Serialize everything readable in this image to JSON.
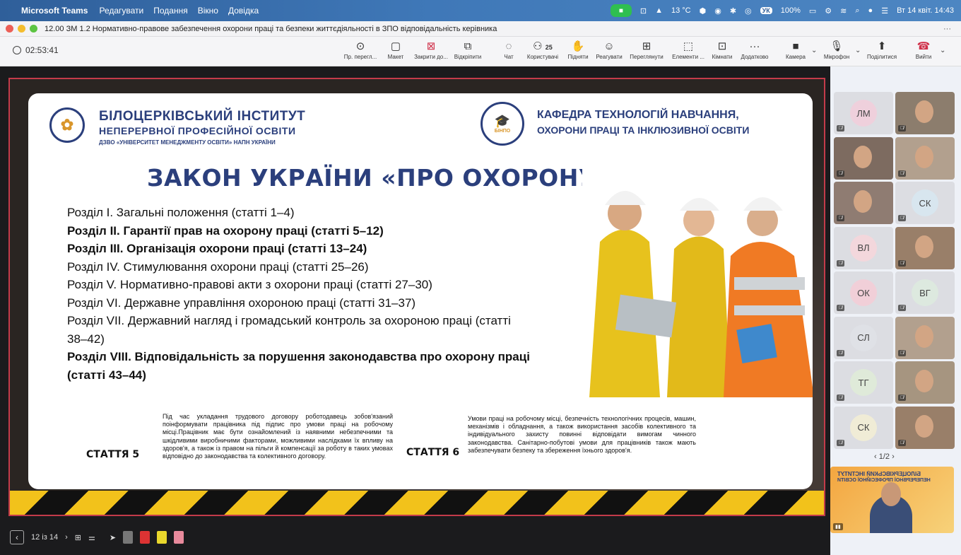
{
  "menubar": {
    "app": "Microsoft Teams",
    "items": [
      "Редагувати",
      "Подання",
      "Вікно",
      "Довідка"
    ],
    "temperature": "13 °C",
    "battery": "100%",
    "lang": "УК",
    "datetime": "Вт 14 квіт. 14:43"
  },
  "window": {
    "title": "12.00 ЗМ 1.2 Нормативно-правове забезпечення охорони праці та безпеки життєдіяльності в ЗПО відповідальність керівника"
  },
  "toolbar": {
    "timer": "02:53:41",
    "buttons": [
      {
        "icon": "view-icon",
        "label": "Пр. перегл..."
      },
      {
        "icon": "layout-icon",
        "label": "Макет"
      },
      {
        "icon": "close-share-icon",
        "label": "Закрити до..."
      },
      {
        "icon": "unpin-icon",
        "label": "Відкріпити"
      },
      {
        "icon": "chat-icon",
        "label": "Чат"
      },
      {
        "icon": "people-icon",
        "label": "Користувачі",
        "badge": "25"
      },
      {
        "icon": "raise-hand-icon",
        "label": "Підняти"
      },
      {
        "icon": "react-icon",
        "label": "Реагувати"
      },
      {
        "icon": "view-grid-icon",
        "label": "Переглянути"
      },
      {
        "icon": "apps-icon",
        "label": "Елементи ..."
      },
      {
        "icon": "rooms-icon",
        "label": "Кімнати"
      },
      {
        "icon": "more-icon",
        "label": "Додатково"
      },
      {
        "icon": "camera-icon",
        "label": "Камера"
      },
      {
        "icon": "mic-icon",
        "label": "Мікрофон"
      },
      {
        "icon": "share-icon",
        "label": "Поділитися"
      },
      {
        "icon": "leave-icon",
        "label": "Вийти"
      }
    ]
  },
  "slide": {
    "inst_line1": "БІЛОЦЕРКІВСЬКИЙ ІНСТИТУТ",
    "inst_line2": "НЕПЕРЕРВНОЇ ПРОФЕСІЙНОЇ ОСВІТИ",
    "inst_line3": "ДЗВО «УНІВЕРСИТЕТ МЕНЕДЖМЕНТУ ОСВІТИ» НАПН УКРАЇНИ",
    "logo_r_text": "БІНПО",
    "kaf_line1": "КАФЕДРА ТЕХНОЛОГІЙ НАВЧАННЯ,",
    "kaf_line2": "ОХОРОНИ ПРАЦІ ТА ІНКЛЮЗИВНОЇ ОСВІТИ",
    "title": "ЗАКОН УКРАЇНИ «ПРО ОХОРОНУ ПРАЦІ»",
    "sections": [
      "Розділ I. Загальні положення (статті 1–4)",
      "Розділ II. Гарантії прав на охорону праці (статті 5–12)",
      "Розділ III. Організація охорони праці (статті 13–24)",
      "Розділ IV. Стимулювання охорони праці (статті 25–26)",
      "Розділ V. Нормативно-правові акти з охорони праці (статті 27–30)",
      "Розділ VI. Державне управління охороною праці (статті 31–37)",
      "Розділ VII. Державний нагляд і громадський контроль за охороною праці (статті 38–42)",
      "Розділ VIII. Відповідальність за порушення законодавства про охорону праці (статті 43–44)"
    ],
    "art5_label": "СТАТТЯ 5",
    "art5_text": "Під час укладання трудового договору роботодавець зобов'язаний поінформувати працівника під підпис про умови праці на робочому місці.Працівник має бути ознайомлений із наявними небезпечними та шкідливими виробничими факторами, можливими наслідками їх впливу на здоров'я, а також із правом на пільги й компенсації за роботу в таких умовах відповідно до законодавства та колективного договору.",
    "art6_label": "СТАТТЯ 6",
    "art6_text": "Умови праці на робочому місці, безпечність технологічних процесів, машин, механізмів і обладнання, а також використання засобів колективного та індивідуального захисту повинні відповідати вимогам чинного законодавства. Санітарно-побутові умови для працівників також мають забезпечувати безпеку та збереження їхнього здоров'я."
  },
  "slidectl": {
    "page": "12 із 14"
  },
  "participants": [
    {
      "initials": "ЛМ",
      "type": "init",
      "color": "#efd0dc"
    },
    {
      "initials": "",
      "type": "cam"
    },
    {
      "initials": "",
      "type": "cam"
    },
    {
      "initials": "",
      "type": "cam"
    },
    {
      "initials": "",
      "type": "cam"
    },
    {
      "initials": "СК",
      "type": "init",
      "color": "#d8e6ef"
    },
    {
      "initials": "ВЛ",
      "type": "init",
      "color": "#f3d7dc"
    },
    {
      "initials": "",
      "type": "cam"
    },
    {
      "initials": "ОК",
      "type": "init",
      "color": "#f1cfd8"
    },
    {
      "initials": "ВГ",
      "type": "init",
      "color": "#dde9df"
    },
    {
      "initials": "СЛ",
      "type": "init",
      "color": "#dfe1e6"
    },
    {
      "initials": "",
      "type": "cam"
    },
    {
      "initials": "ТГ",
      "type": "init",
      "color": "#dfead9"
    },
    {
      "initials": "",
      "type": "cam"
    },
    {
      "initials": "СК",
      "type": "init",
      "color": "#f0ecd6"
    },
    {
      "initials": "",
      "type": "cam"
    }
  ],
  "pager": "1/2",
  "preview": {
    "line1": "БІЛОЦЕРКІВСЬКИЙ ІНСТИТУТ",
    "line2": "НЕПЕРЕРВНОЇ ПРОФЕСІЙНОЇ ОСВІТИ"
  }
}
